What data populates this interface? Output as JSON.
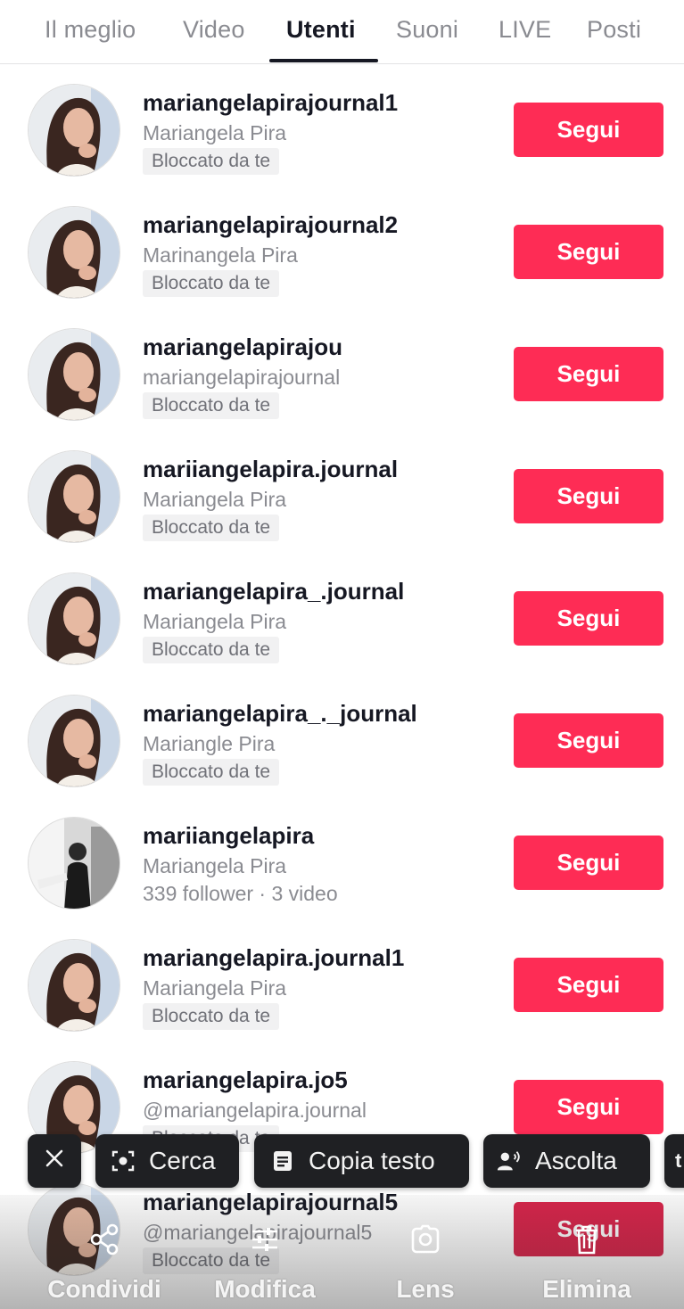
{
  "tabs": [
    "Il meglio",
    "Video",
    "Utenti",
    "Suoni",
    "LIVE",
    "Posti"
  ],
  "active_tab": "Utenti",
  "follow_label": "Segui",
  "users": [
    {
      "username": "mariangelapirajournal1",
      "nickname": "Mariangela Pira",
      "status": "Bloccato da te",
      "avatar": "woman-photo"
    },
    {
      "username": "mariangelapirajournal2",
      "nickname": "Marinangela Pira",
      "status": "Bloccato da te",
      "avatar": "woman-photo"
    },
    {
      "username": "mariangelapirajou",
      "nickname": "mariangelapirajournal",
      "status": "Bloccato da te",
      "avatar": "woman-photo"
    },
    {
      "username": "mariiangelapira.journal",
      "nickname": "Mariangela Pira",
      "status": "Bloccato da te",
      "avatar": "woman-photo"
    },
    {
      "username": "mariangelapira_.journal",
      "nickname": "Mariangela Pira",
      "status": "Bloccato da te",
      "avatar": "woman-photo"
    },
    {
      "username": "mariangelapira_._journal",
      "nickname": "Mariangle Pira",
      "status": "Bloccato da te",
      "avatar": "woman-photo"
    },
    {
      "username": "mariiangelapira",
      "nickname": "Mariangela Pira",
      "stats": "339 follower · 3 video",
      "avatar": "bw-photo"
    },
    {
      "username": "mariangelapira.journal1",
      "nickname": "Mariangela Pira",
      "status": "Bloccato da te",
      "avatar": "woman-photo"
    },
    {
      "username": "mariangelapira.jo5",
      "nickname": "@mariangelapira.journal",
      "status": "Bloccato da te",
      "avatar": "woman-photo"
    },
    {
      "username": "mariangelapirajournal5",
      "nickname": "@mariangelapirajournal5",
      "status": "Bloccato da te",
      "avatar": "woman-photo"
    }
  ],
  "selection_toolbar": {
    "close_icon": "close-icon",
    "cerca": "Cerca",
    "copia_testo": "Copia testo",
    "ascolta": "Ascolta"
  },
  "bottom_bar": {
    "condividi": "Condividi",
    "modifica": "Modifica",
    "lens": "Lens",
    "elimina": "Elimina"
  },
  "colors": {
    "accent": "#fe2c55",
    "text_primary": "#161823",
    "text_secondary": "#8a8b91",
    "chip_bg": "#1f2023"
  }
}
